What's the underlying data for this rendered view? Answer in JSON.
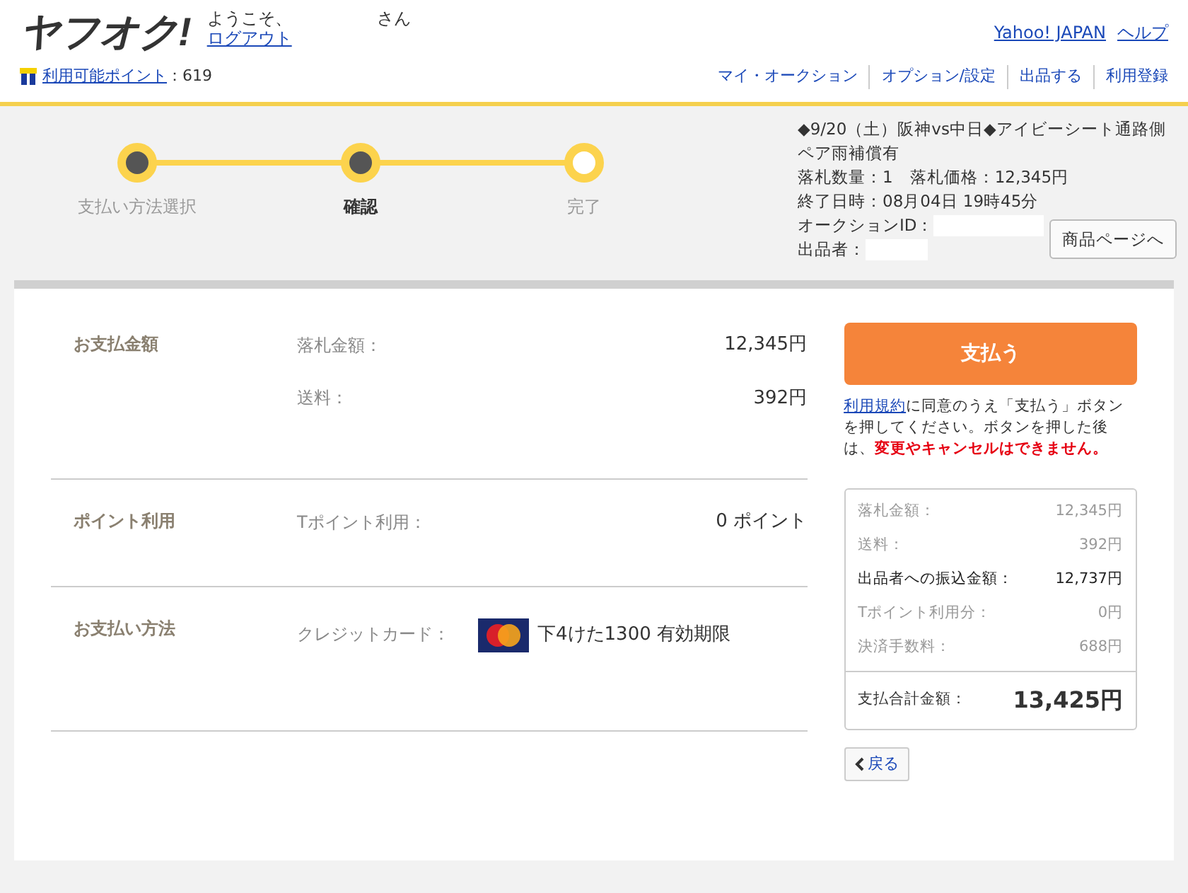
{
  "header": {
    "logo": "ヤフオク!",
    "welcome": "ようこそ、",
    "honorific": "さん",
    "logout": "ログアウト",
    "links": [
      "Yahoo! JAPAN",
      "ヘルプ"
    ],
    "points": {
      "label": "利用可能ポイント",
      "value": "：619"
    },
    "nav": [
      "マイ・オークション",
      "オプション/設定",
      "出品する",
      "利用登録"
    ]
  },
  "steps": [
    {
      "label": "支払い方法選択",
      "reached": true,
      "selected": false
    },
    {
      "label": "確認",
      "reached": true,
      "selected": true
    },
    {
      "label": "完了",
      "reached": false,
      "selected": false
    }
  ],
  "auction": {
    "title": "◆9/20（土）阪神vs中日◆アイビーシート通路側ペア雨補償有",
    "lines": [
      "落札数量：1　落札価格：12,345円",
      "終了日時：08月04日 19時45分"
    ],
    "id_label": "オークションID：",
    "seller_label": "出品者：",
    "button": "商品ページへ"
  },
  "sections": [
    {
      "title": "お支払金額",
      "kind": "amounts",
      "rows": [
        {
          "label": "落札金額：",
          "value": "12,345円"
        },
        {
          "label": "送料：",
          "value": "392円"
        }
      ]
    },
    {
      "title": "ポイント利用",
      "kind": "amounts",
      "rows": [
        {
          "label": "Tポイント利用：",
          "value": "0 ポイント"
        }
      ]
    },
    {
      "title": "お支払い方法",
      "kind": "card",
      "rows": [
        {
          "label": "クレジットカード：",
          "value": "下4けた1300 有効期限"
        }
      ]
    }
  ],
  "pay_button": "支払う",
  "notice": {
    "link": "利用規約",
    "text": "に同意のうえ「支払う」ボタンを押してください。ボタンを押した後は、",
    "warning": "変更やキャンセルはできません。"
  },
  "summary": {
    "rows": [
      {
        "label": "落札金額：",
        "value": "12,345円",
        "emphasis": false
      },
      {
        "label": "送料：",
        "value": "392円",
        "emphasis": false
      },
      {
        "label": "出品者への振込金額：",
        "value": "12,737円",
        "emphasis": true
      },
      {
        "label": "Tポイント利用分：",
        "value": "0円",
        "emphasis": false
      },
      {
        "label": "決済手数料：",
        "value": "688円",
        "emphasis": false
      }
    ],
    "total_label": "支払合計金額：",
    "total_value": "13,425円"
  },
  "back_button": "戻る"
}
